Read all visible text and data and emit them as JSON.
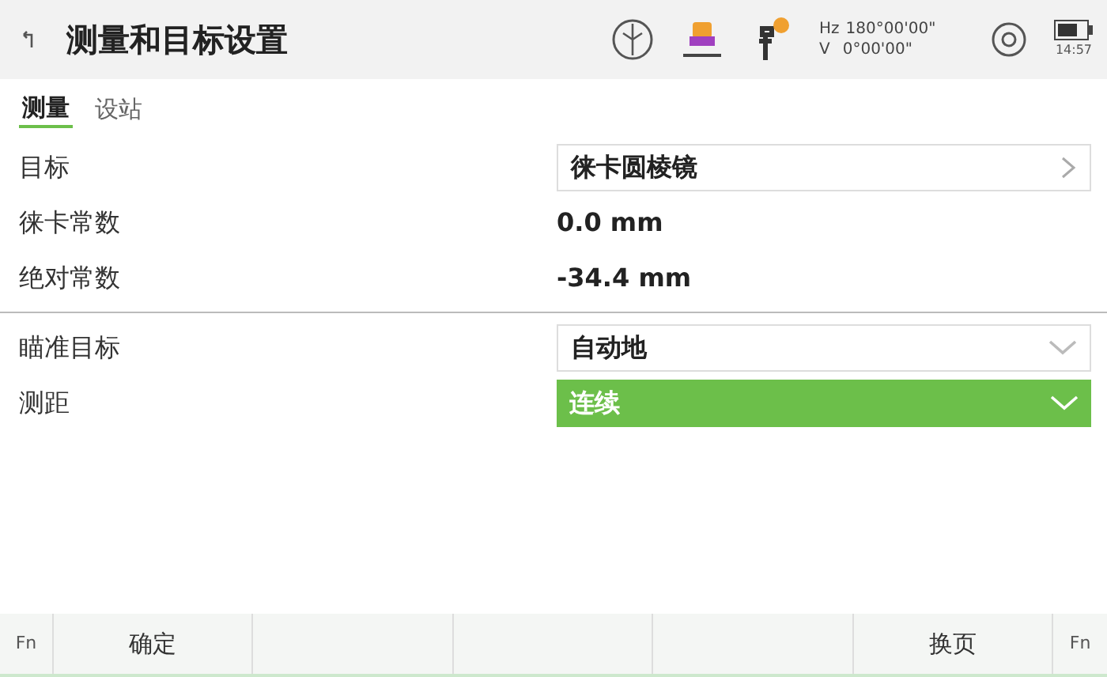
{
  "window": {
    "title": "测量和目标设置"
  },
  "status": {
    "hz_label": "Hz",
    "hz": "180°00'00\"",
    "v_label": "V",
    "v": "0°00'00\"",
    "time": "14:57"
  },
  "tabs": [
    {
      "label": "测量",
      "selected": true
    },
    {
      "label": "设站",
      "selected": false
    }
  ],
  "groups": [
    {
      "rows": [
        {
          "label": "目标",
          "kind": "link",
          "value": "徕卡圆棱镜",
          "focused": false
        },
        {
          "label": "徕卡常数",
          "kind": "value",
          "value": "0.0 mm"
        },
        {
          "label": "绝对常数",
          "kind": "value",
          "value": "-34.4 mm"
        }
      ]
    },
    {
      "rows": [
        {
          "label": "瞄准目标",
          "kind": "dropdown",
          "value": "自动地",
          "focused": false
        },
        {
          "label": "测距",
          "kind": "dropdown",
          "value": "连续",
          "focused": true
        }
      ]
    }
  ],
  "footer": {
    "left_fn": "Fn",
    "buttons": [
      {
        "label": "确定",
        "kind": "left"
      },
      {
        "label": "换页",
        "kind": "right"
      }
    ],
    "right_fn": "Fn"
  }
}
